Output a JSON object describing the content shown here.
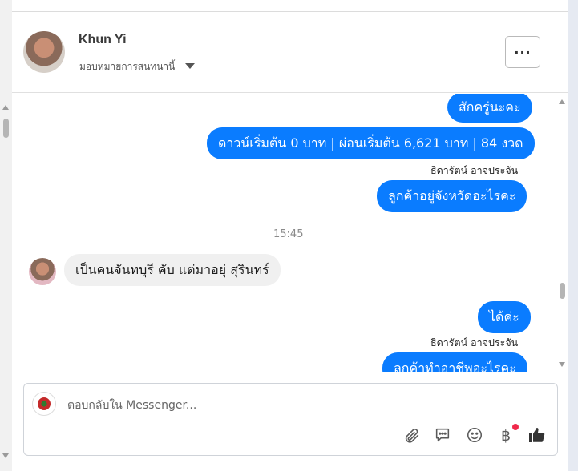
{
  "header": {
    "name": "Khun Yi",
    "assign_label": "มอบหมายการสนทนานี้",
    "more_label": "···"
  },
  "messages": {
    "out1": "สักครู่นะคะ",
    "out2": "ดาวน์เริ่มต้น 0 บาท | ผ่อนเริ่มต้น 6,621 บาท | 84 งวด",
    "sender1": "ธิดารัตน์ อาจประจัน",
    "out3": "ลูกค้าอยู่จังหวัดอะไรคะ",
    "time": "15:45",
    "in1": "เป็นคนจันทบุรี คับ แต่มาอยุ่ สุรินทร์",
    "out4": "ได้ค่ะ",
    "sender2": "ธิดารัตน์ อาจประจัน",
    "out5": "ลูกค้าทำอาชีพอะไรคะ"
  },
  "composer": {
    "placeholder": "ตอบกลับใน Messenger...",
    "currency_symbol": "฿"
  },
  "colors": {
    "bubble_out": "#0a7cff",
    "bubble_in": "#f0f0f0",
    "badge": "#f0284a"
  }
}
